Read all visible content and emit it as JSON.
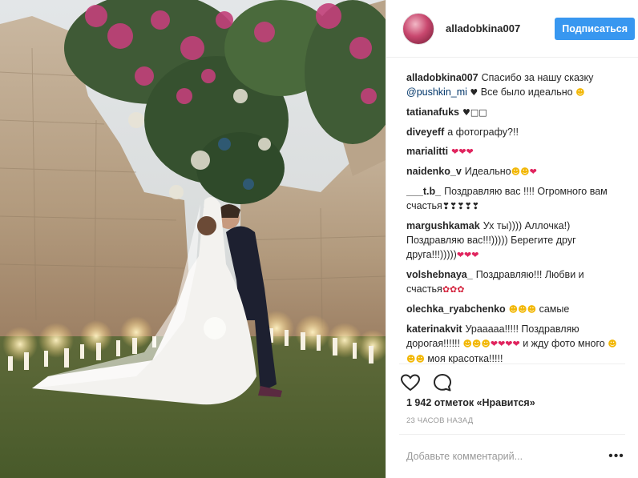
{
  "header": {
    "username": "alladobkina007",
    "follow_label": "Подписаться"
  },
  "caption": {
    "user": "alladobkina007",
    "text_before": "Спасибо за нашу сказку ",
    "mention": "@pushkin_mi",
    "text_after": " Все было идеально "
  },
  "comments": [
    {
      "user": "tatianafuks",
      "text": "",
      "emoji": [
        "heart-black",
        "square",
        "square"
      ]
    },
    {
      "user": "diveyeff",
      "text": "а фотографу?!!",
      "emoji": []
    },
    {
      "user": "marialitti",
      "text": "",
      "emoji": [
        "heart-red",
        "heart-red",
        "heart-red"
      ]
    },
    {
      "user": "naidenko_v",
      "text": "Идеально",
      "emoji": [
        "smile",
        "smile",
        "heart-red"
      ]
    },
    {
      "user": "___t.b_",
      "text": "Поздравляю вас !!!! Огромного вам счастья",
      "emoji": [
        "heart-black",
        "heart-black",
        "heart-black",
        "heart-black",
        "heart-black"
      ]
    },
    {
      "user": "margushkamak",
      "text": "Ух ты)))) Аллочка!) Поздравляю вас!!!))))) Берегите друг друга!!!)))))",
      "emoji": [
        "heart-red",
        "heart-red",
        "heart-red"
      ]
    },
    {
      "user": "volshebnaya_",
      "text": "Поздравляю!!! Любви и счастья",
      "emoji": [
        "rose",
        "rose",
        "rose"
      ]
    },
    {
      "user": "olechka_ryabchenko",
      "text": "самые",
      "emoji_before": [
        "smile",
        "smile",
        "smile"
      ]
    },
    {
      "user": "katerinakvit",
      "text_a": "Урааааа!!!!! Поздравляю дорогая!!!!!! ",
      "text_b": " и жду фото много ",
      "text_c": " моя красотка!!!!!"
    }
  ],
  "likes_text": "1 942 отметок «Нравится»",
  "timestamp": "23 ЧАСОВ НАЗАД",
  "add_comment_placeholder": "Добавьте комментарий...",
  "more_icon": "•••",
  "icons": {
    "like": "heart-outline-icon",
    "comment": "speech-bubble-icon"
  },
  "colors": {
    "follow_button": "#3897f0",
    "mention": "#003569",
    "heart": "#e0245e"
  }
}
